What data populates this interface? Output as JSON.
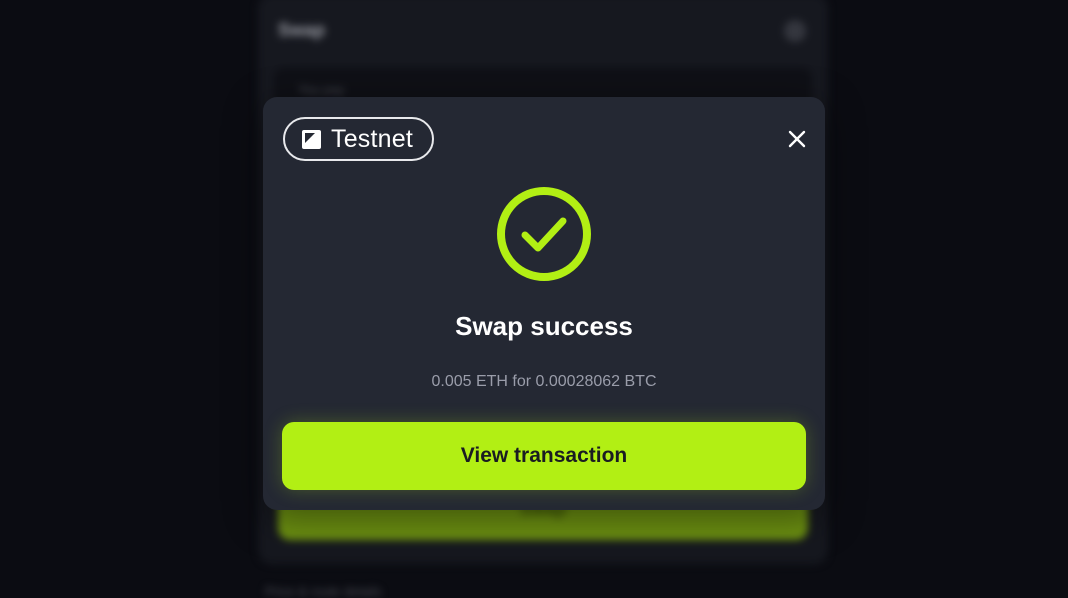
{
  "background": {
    "panel_title": "Swap",
    "field_label": "You pay",
    "swap_button_label": "Swap",
    "footer_text": "Price & route details"
  },
  "modal": {
    "network_badge": "Testnet",
    "title": "Swap success",
    "subtitle": "0.005 ETH for 0.00028062 BTC",
    "primary_button": "View transaction"
  },
  "icons": {
    "network": "testnet-icon",
    "close": "close-icon",
    "success": "check-circle-icon"
  },
  "colors": {
    "accent": "#b2ef14",
    "modal_bg": "#242833",
    "page_bg": "#0b0c12",
    "subtitle": "#9a9daa"
  }
}
